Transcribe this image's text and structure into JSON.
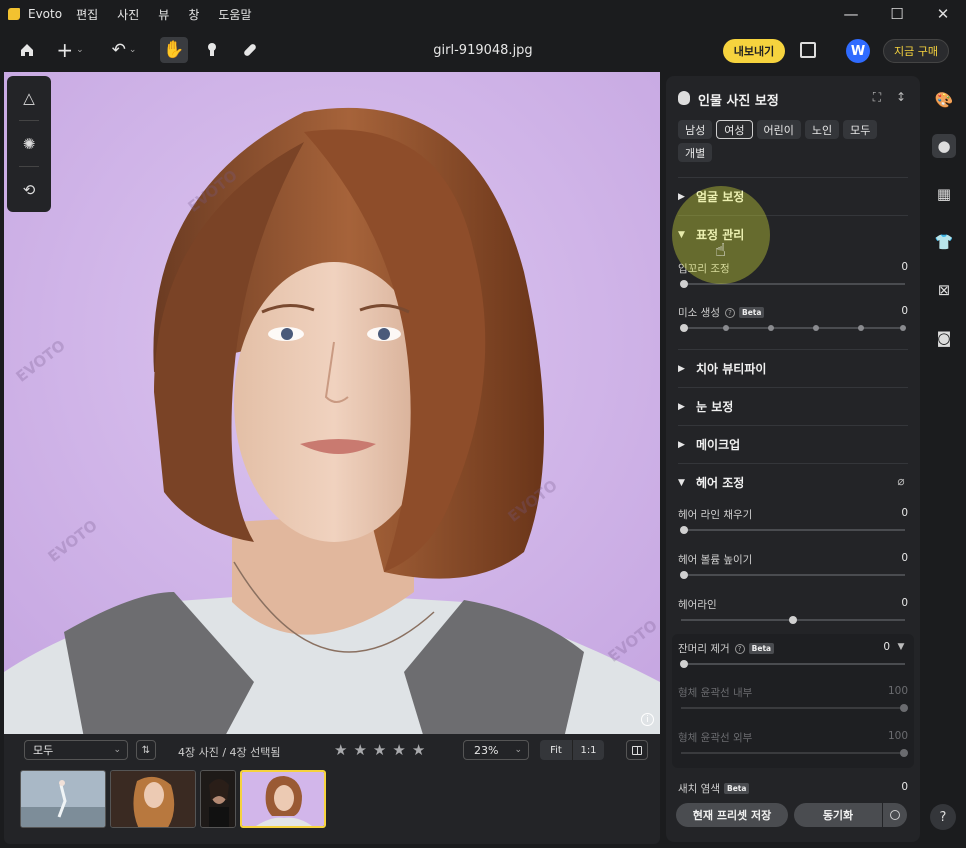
{
  "app": {
    "name": "Evoto",
    "logo_color": "#f2c230"
  },
  "menu": [
    "편집",
    "사진",
    "뷰",
    "창",
    "도움말"
  ],
  "window_controls": {
    "minimize": "—",
    "maximize": "☐",
    "close": "✕"
  },
  "toolbar": {
    "file_title": "girl-919048.jpg",
    "export_label": "내보내기",
    "avatar_letter": "W",
    "buy_label": "지금 구매"
  },
  "left_tools": [
    "triangle-mountain-icon",
    "sparkle-circle-icon",
    "history-icon"
  ],
  "bottom": {
    "filter_value": "모두",
    "count_text": "4장 사진 / 4장 선택됨",
    "rating_stars": 5,
    "rating_value": 0,
    "zoom_value": "23%",
    "fit_label": "Fit",
    "one_to_one_label": "1:1",
    "thumbnails_count": 4,
    "active_thumbnail": 4
  },
  "panel": {
    "title": "인물 사진 보정",
    "chips": [
      {
        "label": "남성",
        "active": false
      },
      {
        "label": "여성",
        "active": true
      },
      {
        "label": "어린이",
        "active": false
      },
      {
        "label": "노인",
        "active": false
      },
      {
        "label": "모두",
        "active": false
      },
      {
        "label": "개별",
        "active": false
      }
    ],
    "sections": {
      "face": "얼굴 보정",
      "expression": "표정 관리",
      "teeth": "치아 뷰티파이",
      "eyes": "눈 보정",
      "makeup": "메이크업",
      "hair": "헤어 조정"
    },
    "sliders": {
      "mouth_corner": {
        "label": "입꼬리 조정",
        "value": "0"
      },
      "smile": {
        "label": "미소 생성",
        "value": "0",
        "beta": "Beta"
      },
      "hairline_fill": {
        "label": "헤어 라인 채우기",
        "value": "0"
      },
      "hair_volume": {
        "label": "헤어 볼륨 높이기",
        "value": "0"
      },
      "hairline": {
        "label": "헤어라인",
        "value": "0"
      },
      "flyaway": {
        "label": "잔머리 제거",
        "value": "0",
        "beta": "Beta"
      },
      "inner_outline": {
        "label": "형체 윤곽선 내부",
        "value": "100"
      },
      "outer_outline": {
        "label": "형체 윤곽선 외부",
        "value": "100"
      },
      "hair_dye": {
        "label": "새치 염색",
        "value": "0",
        "beta": "Beta"
      }
    },
    "preset_save_label": "현재 프리셋 저장",
    "sync_label": "동기화"
  },
  "right_strip": [
    "palette-icon",
    "face-icon",
    "background-icon",
    "clothing-icon",
    "crop-icon",
    "camera-icon"
  ],
  "help_label": "?",
  "colors": {
    "accent": "#f6d33e",
    "canvas_bg": "#d2b6ea",
    "panel_bg": "#232427"
  }
}
